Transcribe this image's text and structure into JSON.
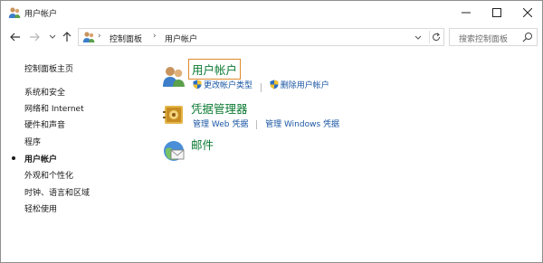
{
  "window": {
    "title": "用户帐户"
  },
  "address_bar": {
    "crumbs": [
      "控制面板",
      "用户帐户"
    ],
    "separator": "›"
  },
  "search": {
    "placeholder": "搜索控制面板"
  },
  "sidebar": {
    "items": [
      {
        "label": "控制面板主页",
        "current": false
      },
      {
        "label": "系统和安全",
        "current": false
      },
      {
        "label": "网络和 Internet",
        "current": false
      },
      {
        "label": "硬件和声音",
        "current": false
      },
      {
        "label": "程序",
        "current": false
      },
      {
        "label": "用户帐户",
        "current": true
      },
      {
        "label": "外观和个性化",
        "current": false
      },
      {
        "label": "时钟、语言和区域",
        "current": false
      },
      {
        "label": "轻松使用",
        "current": false
      }
    ]
  },
  "categories": [
    {
      "title": "用户帐户",
      "icon": "users-icon",
      "links": [
        "更改帐户类型",
        "删除用户帐户"
      ]
    },
    {
      "title": "凭据管理器",
      "icon": "credential-vault-icon",
      "links": [
        "管理 Web 凭据",
        "管理 Windows 凭据"
      ]
    },
    {
      "title": "邮件",
      "icon": "mail-icon",
      "links": []
    }
  ],
  "colors": {
    "category_title": "#0b7a32",
    "link": "#1a56a3",
    "focus_outline": "#e08a2c"
  }
}
